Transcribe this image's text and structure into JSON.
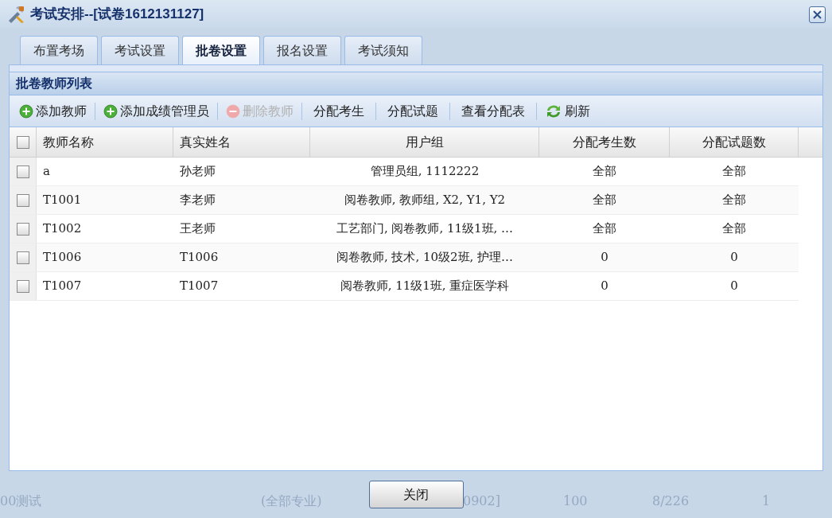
{
  "window": {
    "title": "考试安排--[试卷1612131127]"
  },
  "tabs": [
    {
      "label": "布置考场",
      "selected": false
    },
    {
      "label": "考试设置",
      "selected": false
    },
    {
      "label": "批卷设置",
      "selected": true
    },
    {
      "label": "报名设置",
      "selected": false
    },
    {
      "label": "考试须知",
      "selected": false
    }
  ],
  "panel": {
    "title": "批卷教师列表"
  },
  "toolbar": [
    {
      "label": "添加教师",
      "kind": "add",
      "disabled": false
    },
    {
      "label": "添加成绩管理员",
      "kind": "add",
      "disabled": false
    },
    {
      "label": "删除教师",
      "kind": "remove",
      "disabled": true
    },
    {
      "label": "分配考生",
      "kind": "plain",
      "disabled": false
    },
    {
      "label": "分配试题",
      "kind": "plain",
      "disabled": false
    },
    {
      "label": "查看分配表",
      "kind": "plain",
      "disabled": false
    },
    {
      "label": "刷新",
      "kind": "refresh",
      "disabled": false
    }
  ],
  "table": {
    "select_all": {
      "checked": false
    },
    "columns": [
      "教师名称",
      "真实姓名",
      "用户组",
      "分配考生数",
      "分配试题数"
    ],
    "rows": [
      {
        "checked": false,
        "cells": [
          "a",
          "孙老师",
          "管理员组, 1112222",
          "全部",
          "全部"
        ]
      },
      {
        "checked": false,
        "cells": [
          "T1001",
          "李老师",
          "阅卷教师, 教师组, X2, Y1, Y2",
          "全部",
          "全部"
        ]
      },
      {
        "checked": false,
        "cells": [
          "T1002",
          "王老师",
          "工艺部门, 阅卷教师, 11级1班, …",
          "全部",
          "全部"
        ]
      },
      {
        "checked": false,
        "cells": [
          "T1006",
          "T1006",
          "阅卷教师, 技术, 10级2班, 护理…",
          "0",
          "0"
        ]
      },
      {
        "checked": false,
        "cells": [
          "T1007",
          "T1007",
          "阅卷教师, 11级1班, 重症医学科",
          "0",
          "0"
        ]
      }
    ]
  },
  "background_row": [
    "00测试",
    "(全部专业)",
    "0902]",
    "100",
    "8/226",
    "1"
  ],
  "buttons": [
    "关闭"
  ]
}
